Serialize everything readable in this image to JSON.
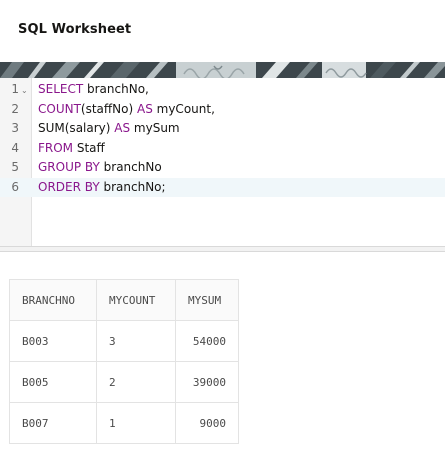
{
  "header": {
    "title": "SQL Worksheet"
  },
  "editor": {
    "lines": [
      {
        "number": "1",
        "tokens": [
          {
            "text": "SELECT",
            "kw": true
          },
          {
            "text": " branchNo,",
            "kw": false
          }
        ]
      },
      {
        "number": "2",
        "tokens": [
          {
            "text": "COUNT",
            "kw": true
          },
          {
            "text": "(staffNo) ",
            "kw": false
          },
          {
            "text": "AS",
            "kw": true
          },
          {
            "text": " myCount,",
            "kw": false
          }
        ]
      },
      {
        "number": "3",
        "tokens": [
          {
            "text": "SUM(salary) ",
            "kw": false
          },
          {
            "text": "AS",
            "kw": true
          },
          {
            "text": " mySum",
            "kw": false
          }
        ]
      },
      {
        "number": "4",
        "tokens": [
          {
            "text": "FROM",
            "kw": true
          },
          {
            "text": " Staff",
            "kw": false
          }
        ]
      },
      {
        "number": "5",
        "tokens": [
          {
            "text": "GROUP BY",
            "kw": true
          },
          {
            "text": " branchNo",
            "kw": false
          }
        ]
      },
      {
        "number": "6",
        "tokens": [
          {
            "text": "ORDER BY",
            "kw": true
          },
          {
            "text": " branchNo;",
            "kw": false
          }
        ]
      }
    ],
    "active_line": "6",
    "fold_icon": "chevron-down-icon",
    "keyword_color": "#8a178c"
  },
  "results": {
    "columns": [
      "BRANCHNO",
      "MYCOUNT",
      "MYSUM"
    ],
    "rows": [
      [
        "B003",
        "3",
        "54000"
      ],
      [
        "B005",
        "2",
        "39000"
      ],
      [
        "B007",
        "1",
        "9000"
      ]
    ]
  }
}
